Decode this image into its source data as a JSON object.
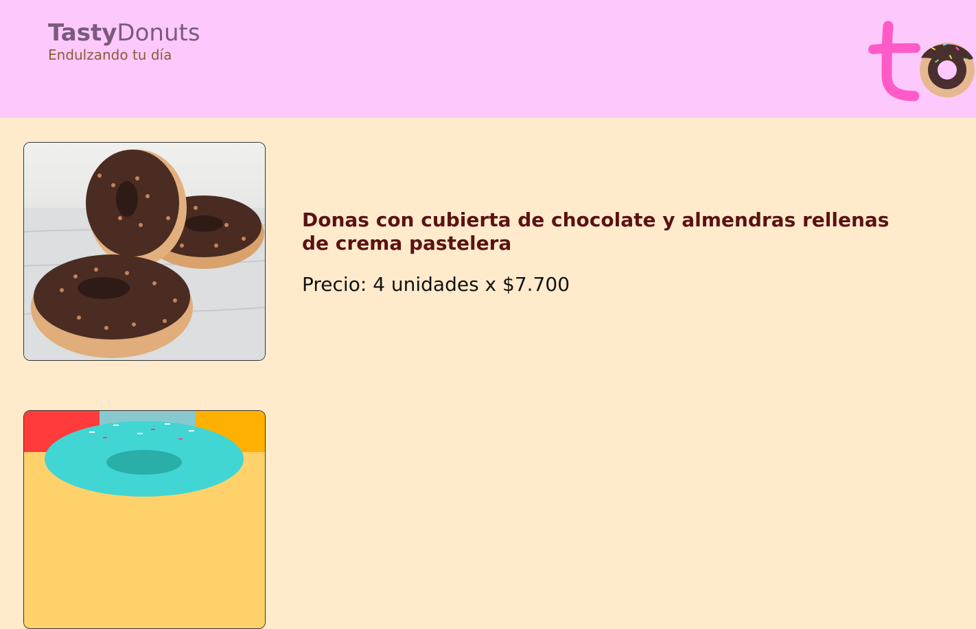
{
  "header": {
    "brand_bold": "Tasty",
    "brand_light": "Donuts",
    "tagline": "Endulzando tu día",
    "logo_icon": "td-donut-logo-icon"
  },
  "products": [
    {
      "title": "Donas con cubierta de chocolate y almendras rellenas de crema pastelera",
      "price": "Precio: 4 unidades x $7.700",
      "image_icon": "chocolate-donuts-image"
    },
    {
      "title": "",
      "price": "",
      "image_icon": "sprinkle-donut-image"
    }
  ],
  "colors": {
    "header_bg": "#fdc9fc",
    "page_bg": "#ffebcc",
    "title": "#5b1212",
    "brand": "#7a5a7d"
  }
}
